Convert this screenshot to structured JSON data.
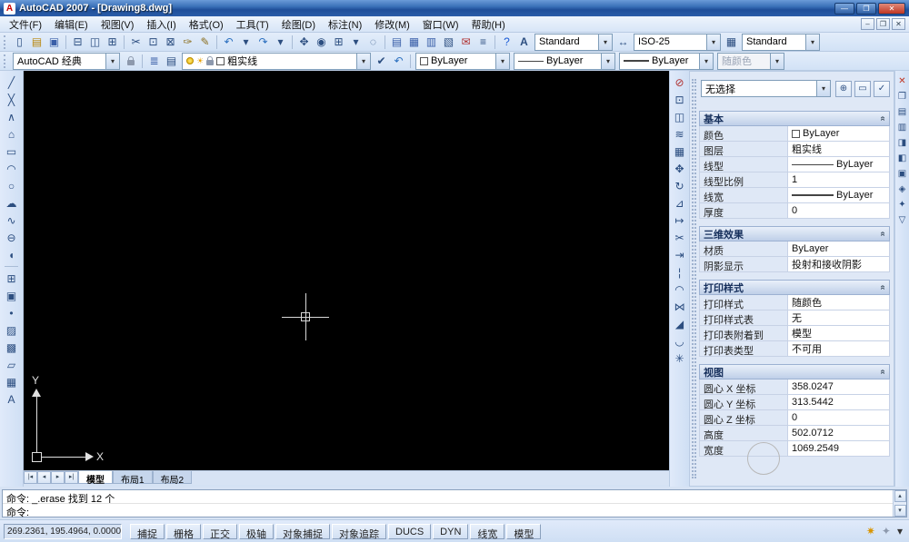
{
  "ui": {
    "dropdown_arrow": "▾",
    "collapse_glyph": "«",
    "win_min": "—",
    "win_restore": "❐",
    "win_close": "✕",
    "child_min": "‒",
    "child_restore": "❐",
    "child_close": "✕",
    "arrow_up": "▴",
    "arrow_down": "▾"
  },
  "titlebar": {
    "title": "AutoCAD 2007 - [Drawing8.dwg]",
    "app_icon_letter": "A"
  },
  "menubar": {
    "items": [
      "文件(F)",
      "编辑(E)",
      "视图(V)",
      "插入(I)",
      "格式(O)",
      "工具(T)",
      "绘图(D)",
      "标注(N)",
      "修改(M)",
      "窗口(W)",
      "帮助(H)"
    ]
  },
  "toolbar_standard": {
    "icons": [
      {
        "name": "qnew-icon",
        "glyph": "▯"
      },
      {
        "name": "open-icon",
        "glyph": "▤",
        "color": "#b8860b"
      },
      {
        "name": "save-icon",
        "glyph": "▣",
        "color": "#3a5fa8"
      },
      {
        "sep": true
      },
      {
        "name": "plot-icon",
        "glyph": "⊟"
      },
      {
        "name": "plot-preview-icon",
        "glyph": "◫"
      },
      {
        "name": "publish-icon",
        "glyph": "⊞"
      },
      {
        "sep": true
      },
      {
        "name": "cut-icon",
        "glyph": "✂"
      },
      {
        "name": "copy-icon",
        "glyph": "⊡"
      },
      {
        "name": "paste-icon",
        "glyph": "⊠"
      },
      {
        "name": "match-properties-icon",
        "glyph": "✑",
        "color": "#8a6d1d"
      },
      {
        "name": "block-editor-icon",
        "glyph": "✎",
        "color": "#8a6d1d"
      },
      {
        "sep": true
      },
      {
        "name": "undo-icon",
        "glyph": "↶",
        "color": "#2b6fbf"
      },
      {
        "name": "undo-dropdown-icon",
        "glyph": "▾"
      },
      {
        "name": "redo-icon",
        "glyph": "↷",
        "color": "#2b6fbf"
      },
      {
        "name": "redo-dropdown-icon",
        "glyph": "▾"
      },
      {
        "sep": true
      },
      {
        "name": "pan-icon",
        "glyph": "✥"
      },
      {
        "name": "zoom-realtime-icon",
        "glyph": "◉"
      },
      {
        "name": "zoom-window-icon",
        "glyph": "⊞"
      },
      {
        "name": "zoom-dropdown-icon",
        "glyph": "▾"
      },
      {
        "name": "zoom-previous-icon",
        "glyph": "◌"
      },
      {
        "sep": true
      },
      {
        "name": "properties-icon",
        "glyph": "▤",
        "color": "#3a5fa8"
      },
      {
        "name": "designcenter-icon",
        "glyph": "▦",
        "color": "#3a5fa8"
      },
      {
        "name": "tool-palettes-icon",
        "glyph": "▥",
        "color": "#3a5fa8"
      },
      {
        "name": "sheet-set-manager-icon",
        "glyph": "▧"
      },
      {
        "name": "markup-set-manager-icon",
        "glyph": "✉",
        "color": "#b03030"
      },
      {
        "name": "quickcalc-icon",
        "glyph": "≡"
      },
      {
        "sep": true
      },
      {
        "name": "help-icon",
        "glyph": "?",
        "color": "#1a5ad6"
      }
    ],
    "text_style_icon": "A",
    "text_style": "Standard",
    "dim_style_icon": "↔",
    "dim_style": "ISO-25",
    "table_style_icon": "▦",
    "table_style": "Standard"
  },
  "toolbar_layers": {
    "workspace": "AutoCAD 经典",
    "icons_pre": [
      {
        "name": "layer-properties-manager-icon",
        "glyph": "≣",
        "color": "#3a5fa8"
      },
      {
        "name": "layer-states-manager-icon",
        "glyph": "▤"
      }
    ],
    "layer_combo_icons": [
      {
        "name": "layer-on-icon",
        "kind": "bulb"
      },
      {
        "name": "layer-freeze-icon",
        "kind": "glyph",
        "glyph": "☀",
        "color": "#e8a000"
      },
      {
        "name": "layer-lock-icon",
        "kind": "lock"
      },
      {
        "name": "layer-color-swatch",
        "kind": "swatch"
      }
    ],
    "layer": "粗实线",
    "icons_mid": [
      {
        "name": "make-object-layer-current-icon",
        "glyph": "✔"
      },
      {
        "name": "layer-previous-icon",
        "glyph": "↶",
        "color": "#2b6fbf"
      }
    ],
    "color": "ByLayer",
    "linetype": "ByLayer",
    "lineweight": "ByLayer",
    "plot_style": "随颜色"
  },
  "draw_toolbar": {
    "icons": [
      {
        "name": "line-icon",
        "glyph": "╱"
      },
      {
        "name": "construction-line-icon",
        "glyph": "╳"
      },
      {
        "name": "polyline-icon",
        "glyph": "∧"
      },
      {
        "name": "polygon-icon",
        "glyph": "⌂"
      },
      {
        "name": "rectangle-icon",
        "glyph": "▭"
      },
      {
        "name": "arc-icon",
        "glyph": "◠"
      },
      {
        "name": "circle-icon",
        "glyph": "○"
      },
      {
        "name": "revision-cloud-icon",
        "glyph": "☁"
      },
      {
        "name": "spline-icon",
        "glyph": "∿"
      },
      {
        "name": "ellipse-icon",
        "glyph": "⊖"
      },
      {
        "name": "ellipse-arc-icon",
        "glyph": "◖"
      },
      {
        "sep": true
      },
      {
        "name": "insert-block-icon",
        "glyph": "⊞"
      },
      {
        "name": "make-block-icon",
        "glyph": "▣"
      },
      {
        "name": "point-icon",
        "glyph": "•"
      },
      {
        "name": "hatch-icon",
        "glyph": "▨"
      },
      {
        "name": "gradient-icon",
        "glyph": "▩"
      },
      {
        "name": "region-icon",
        "glyph": "▱"
      },
      {
        "name": "table-icon",
        "glyph": "▦"
      },
      {
        "name": "multiline-text-icon",
        "glyph": "A"
      }
    ]
  },
  "modify_toolbar": {
    "icons": [
      {
        "name": "erase-icon",
        "glyph": "⊘",
        "color": "#b03030"
      },
      {
        "name": "copy-object-icon",
        "glyph": "⊡"
      },
      {
        "name": "mirror-icon",
        "glyph": "◫"
      },
      {
        "name": "offset-icon",
        "glyph": "≋"
      },
      {
        "name": "array-icon",
        "glyph": "▦"
      },
      {
        "name": "move-icon",
        "glyph": "✥"
      },
      {
        "name": "rotate-icon",
        "glyph": "↻"
      },
      {
        "name": "scale-icon",
        "glyph": "⊿"
      },
      {
        "name": "stretch-icon",
        "glyph": "↦"
      },
      {
        "name": "trim-icon",
        "glyph": "✂"
      },
      {
        "name": "extend-icon",
        "glyph": "⇥"
      },
      {
        "name": "break-at-point-icon",
        "glyph": "¦"
      },
      {
        "name": "break-icon",
        "glyph": "◠"
      },
      {
        "name": "join-icon",
        "glyph": "⋈"
      },
      {
        "name": "chamfer-icon",
        "glyph": "◢"
      },
      {
        "name": "fillet-icon",
        "glyph": "◡"
      },
      {
        "name": "explode-icon",
        "glyph": "✳"
      }
    ]
  },
  "right_toolbar": {
    "icons": [
      {
        "name": "close-icon",
        "glyph": "✕",
        "color": "#c03522"
      },
      {
        "name": "right-toolbar-icon-2",
        "glyph": "❐"
      },
      {
        "name": "right-toolbar-icon-3",
        "glyph": "▤"
      },
      {
        "name": "right-toolbar-icon-4",
        "glyph": "▥"
      },
      {
        "name": "right-toolbar-icon-5",
        "glyph": "◨"
      },
      {
        "name": "right-toolbar-icon-6",
        "glyph": "◧"
      },
      {
        "name": "right-toolbar-icon-7",
        "glyph": "▣"
      },
      {
        "name": "right-toolbar-icon-8",
        "glyph": "◈"
      },
      {
        "name": "right-toolbar-icon-9",
        "glyph": "✦"
      },
      {
        "name": "right-toolbar-icon-10",
        "glyph": "▽"
      }
    ]
  },
  "properties_panel": {
    "selection": "无选择",
    "header_buttons": [
      {
        "name": "toggle-pickadd-icon",
        "glyph": "⊕"
      },
      {
        "name": "select-objects-icon",
        "glyph": "▭"
      },
      {
        "name": "quick-select-icon",
        "glyph": "✓"
      }
    ],
    "sections": [
      {
        "title": "基本",
        "rows": [
          {
            "label": "颜色",
            "value": "ByLayer",
            "kind": "swatch"
          },
          {
            "label": "图层",
            "value": "粗实线",
            "kind": "text"
          },
          {
            "label": "线型",
            "value": "ByLayer",
            "kind": "line"
          },
          {
            "label": "线型比例",
            "value": "1",
            "kind": "text"
          },
          {
            "label": "线宽",
            "value": "ByLayer",
            "kind": "thickline"
          },
          {
            "label": "厚度",
            "value": "0",
            "kind": "text"
          }
        ]
      },
      {
        "title": "三维效果",
        "rows": [
          {
            "label": "材质",
            "value": "ByLayer",
            "kind": "text"
          },
          {
            "label": "阴影显示",
            "value": "投射和接收阴影",
            "kind": "text"
          }
        ]
      },
      {
        "title": "打印样式",
        "rows": [
          {
            "label": "打印样式",
            "value": "随颜色",
            "kind": "text"
          },
          {
            "label": "打印样式表",
            "value": "无",
            "kind": "text"
          },
          {
            "label": "打印表附着到",
            "value": "模型",
            "kind": "text"
          },
          {
            "label": "打印表类型",
            "value": "不可用",
            "kind": "text"
          }
        ]
      },
      {
        "title": "视图",
        "rows": [
          {
            "label": "圆心 X 坐标",
            "value": "358.0247",
            "kind": "text"
          },
          {
            "label": "圆心 Y 坐标",
            "value": "313.5442",
            "kind": "text"
          },
          {
            "label": "圆心 Z 坐标",
            "value": "0",
            "kind": "text"
          },
          {
            "label": "高度",
            "value": "502.0712",
            "kind": "text"
          },
          {
            "label": "宽度",
            "value": "1069.2549",
            "kind": "text"
          }
        ]
      }
    ]
  },
  "drawing_area": {
    "tab_nav": [
      {
        "name": "tab-nav-first-icon",
        "glyph": "|◂"
      },
      {
        "name": "tab-nav-prev-icon",
        "glyph": "◂"
      },
      {
        "name": "tab-nav-next-icon",
        "glyph": "▸"
      },
      {
        "name": "tab-nav-last-icon",
        "glyph": "▸|"
      }
    ],
    "tabs": [
      {
        "label": "模型",
        "active": true
      },
      {
        "label": "布局1",
        "active": false
      },
      {
        "label": "布局2",
        "active": false
      }
    ],
    "ucs": {
      "x": "X",
      "y": "Y"
    }
  },
  "command_line": {
    "lines": [
      "命令: _.erase 找到 12 个",
      "命令:"
    ]
  },
  "status_bar": {
    "coordinates": "269.2361, 195.4964, 0.0000",
    "buttons": [
      "捕捉",
      "栅格",
      "正交",
      "极轴",
      "对象捕捉",
      "对象追踪",
      "DUCS",
      "DYN",
      "线宽",
      "模型"
    ],
    "right_icons": [
      {
        "name": "communication-center-icon",
        "glyph": "✷",
        "color": "#d89400"
      },
      {
        "name": "status-lock-icon",
        "glyph": "✦",
        "color": "#8d99ad"
      },
      {
        "name": "status-menu-arrow-icon",
        "glyph": "▾",
        "color": "#333"
      }
    ]
  }
}
